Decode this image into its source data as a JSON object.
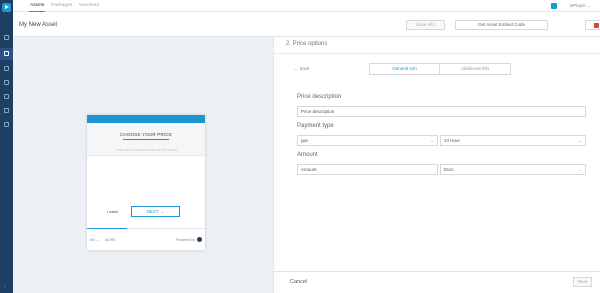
{
  "tabs": [
    {
      "label": "Assets"
    },
    {
      "label": "Packages"
    },
    {
      "label": "Vouchers"
    }
  ],
  "user": {
    "name": "InPlayer",
    "caret": "⌄"
  },
  "header": {
    "title": "My New Asset",
    "save_label": "Save info",
    "embed_label": "Get Asset Embed Code"
  },
  "preview": {
    "choose_label": "CHOOSE YOUR PRICE",
    "hint": "There are no access fees for this asset",
    "price": "/ each",
    "next_label": "NEXT →",
    "language": "EN ⌄",
    "more": "MORE",
    "powered": "Powered by"
  },
  "panel": {
    "title": "2. Price options",
    "back_label": "← back",
    "general_tab": "General info",
    "additional_tab": "Additional info",
    "price_description_label": "Price description",
    "price_description_value": "Price description",
    "payment_type_label": "Payment type",
    "payment_type_value": "ppv",
    "duration_value": "24 Hour",
    "amount_label": "Amount",
    "amount_placeholder": "Amount",
    "currency_value": "Euro",
    "cancel_label": "Cancel",
    "next_label": "Next"
  },
  "colors": {
    "nav": "#1f3e63",
    "accent": "#1d97d4",
    "danger": "#e0453a"
  }
}
